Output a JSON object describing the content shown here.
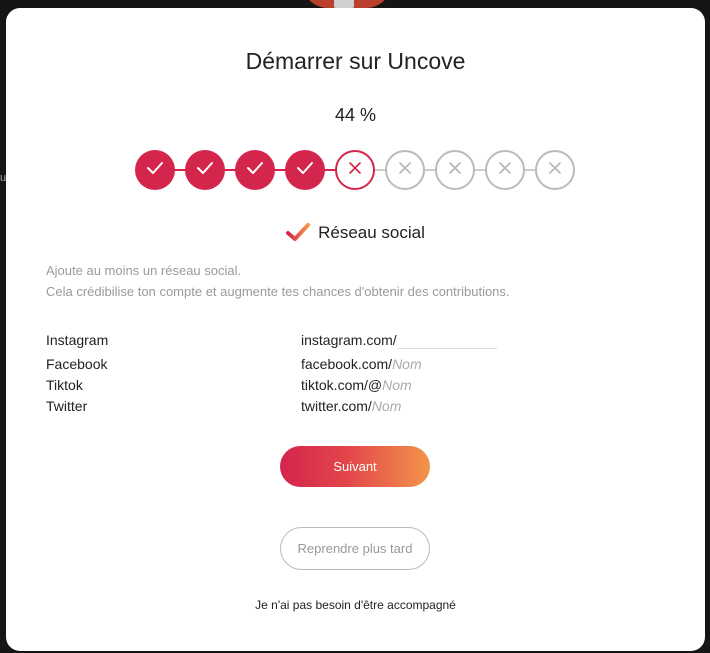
{
  "modal": {
    "title": "Démarrer sur Uncove",
    "progress_text": "44 %",
    "progress_percent": 44,
    "steps": [
      "done",
      "done",
      "done",
      "done",
      "current",
      "todo",
      "todo",
      "todo",
      "todo"
    ],
    "section_title": "Réseau social",
    "description": [
      "Ajoute au moins un réseau social.",
      "Cela crédibilise ton compte et augmente tes chances d'obtenir des contributions."
    ],
    "socials": [
      {
        "label": "Instagram",
        "prefix": "instagram.com/",
        "value": "",
        "placeholder": ""
      },
      {
        "label": "Facebook",
        "prefix": "facebook.com/",
        "value": "",
        "placeholder": "Nom"
      },
      {
        "label": "Tiktok",
        "prefix": "tiktok.com/@",
        "value": "",
        "placeholder": "Nom"
      },
      {
        "label": "Twitter",
        "prefix": "twitter.com/",
        "value": "",
        "placeholder": "Nom"
      }
    ],
    "next_label": "Suivant",
    "later_label": "Reprendre plus tard",
    "no_help_label": "Je n'ai pas besoin d'être accompagné"
  },
  "colors": {
    "accent": "#d4264d",
    "gradient_end": "#f3954a",
    "todo": "#bbbbbb"
  },
  "icons": {
    "step_done": "check-icon",
    "step_pending": "x-icon",
    "section": "orange-check-icon"
  }
}
